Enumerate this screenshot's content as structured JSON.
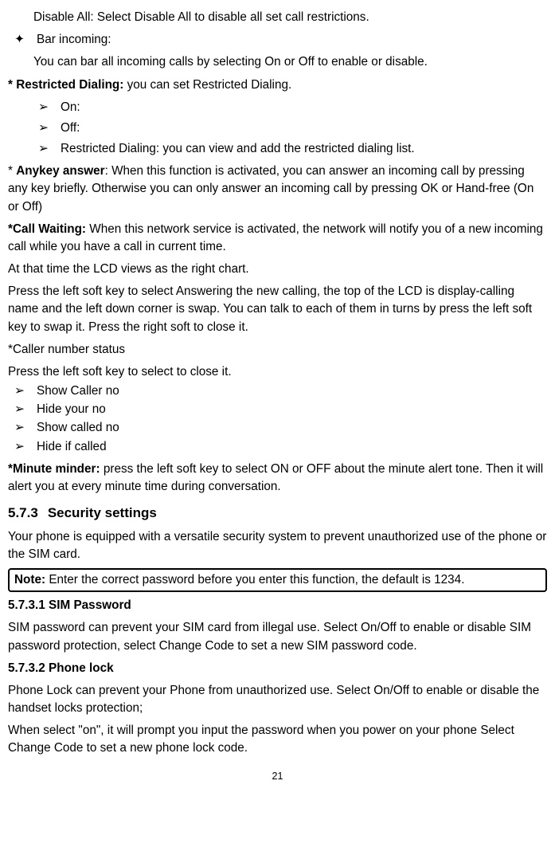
{
  "top": {
    "disable_all": "Disable All: Select Disable All to disable all set call restrictions.",
    "bar_incoming_label": "Bar incoming:",
    "bar_incoming_text": "You can bar all incoming calls by selecting On or Off to enable or disable."
  },
  "restricted": {
    "heading_bold": "* Restricted Dialing:",
    "heading_rest": " you can set Restricted Dialing.",
    "items": {
      "on": "On:",
      "off": "Off:",
      "list": "Restricted Dialing: you can view and add the restricted dialing list."
    }
  },
  "anykey": {
    "prefix": "* ",
    "bold": "Anykey answer",
    "rest": ": When this function is activated, you can answer an incoming call by pressing any key briefly. Otherwise you can only answer an incoming call by pressing OK or Hand-free (On or Off)"
  },
  "callwaiting": {
    "bold": "*Call Waiting:",
    "rest": " When this network service is activated, the network will notify you of a new incoming call while you have a call in current time.",
    "p2": "At that time the LCD views as the right chart.",
    "p3": "Press the left soft key to select Answering the new calling, the top of the LCD is display-calling name and the left down corner is swap. You can talk to each of them in turns by press the left soft key to swap it. Press the right soft to close it."
  },
  "callerstatus": {
    "title": "*Caller number status",
    "p1": "Press the left soft key to select to close it.",
    "items": {
      "a": "Show Caller no",
      "b": "Hide your no",
      "c": "Show called no",
      "d": "Hide if called"
    }
  },
  "minute": {
    "bold": "*Minute minder:",
    "rest": " press the left soft key to select ON or OFF about the minute alert tone. Then it will alert you at every minute time during conversation."
  },
  "security": {
    "num": "5.7.3",
    "title": "Security settings",
    "intro": "Your phone is equipped with a versatile security system to prevent unauthorized use of the phone or the SIM card.",
    "note_bold": "Note:",
    "note_rest": " Enter the correct password before you enter this function, the default is 1234.",
    "sim": {
      "heading": "5.7.3.1 SIM Password",
      "text": "SIM password can prevent your SIM card from illegal use. Select On/Off to enable or disable SIM password protection, select Change Code to set a new SIM password code."
    },
    "phonelock": {
      "heading": "5.7.3.2 Phone lock",
      "p1": "Phone Lock can prevent your Phone from unauthorized use. Select On/Off to enable or disable the handset locks protection;",
      "p2": "When select \"on\", it will prompt you input the password when you power on your phone Select Change Code to set a new phone lock code."
    }
  },
  "page_number": "21",
  "bullets": {
    "diamond": "✦",
    "arrow": "➢"
  }
}
